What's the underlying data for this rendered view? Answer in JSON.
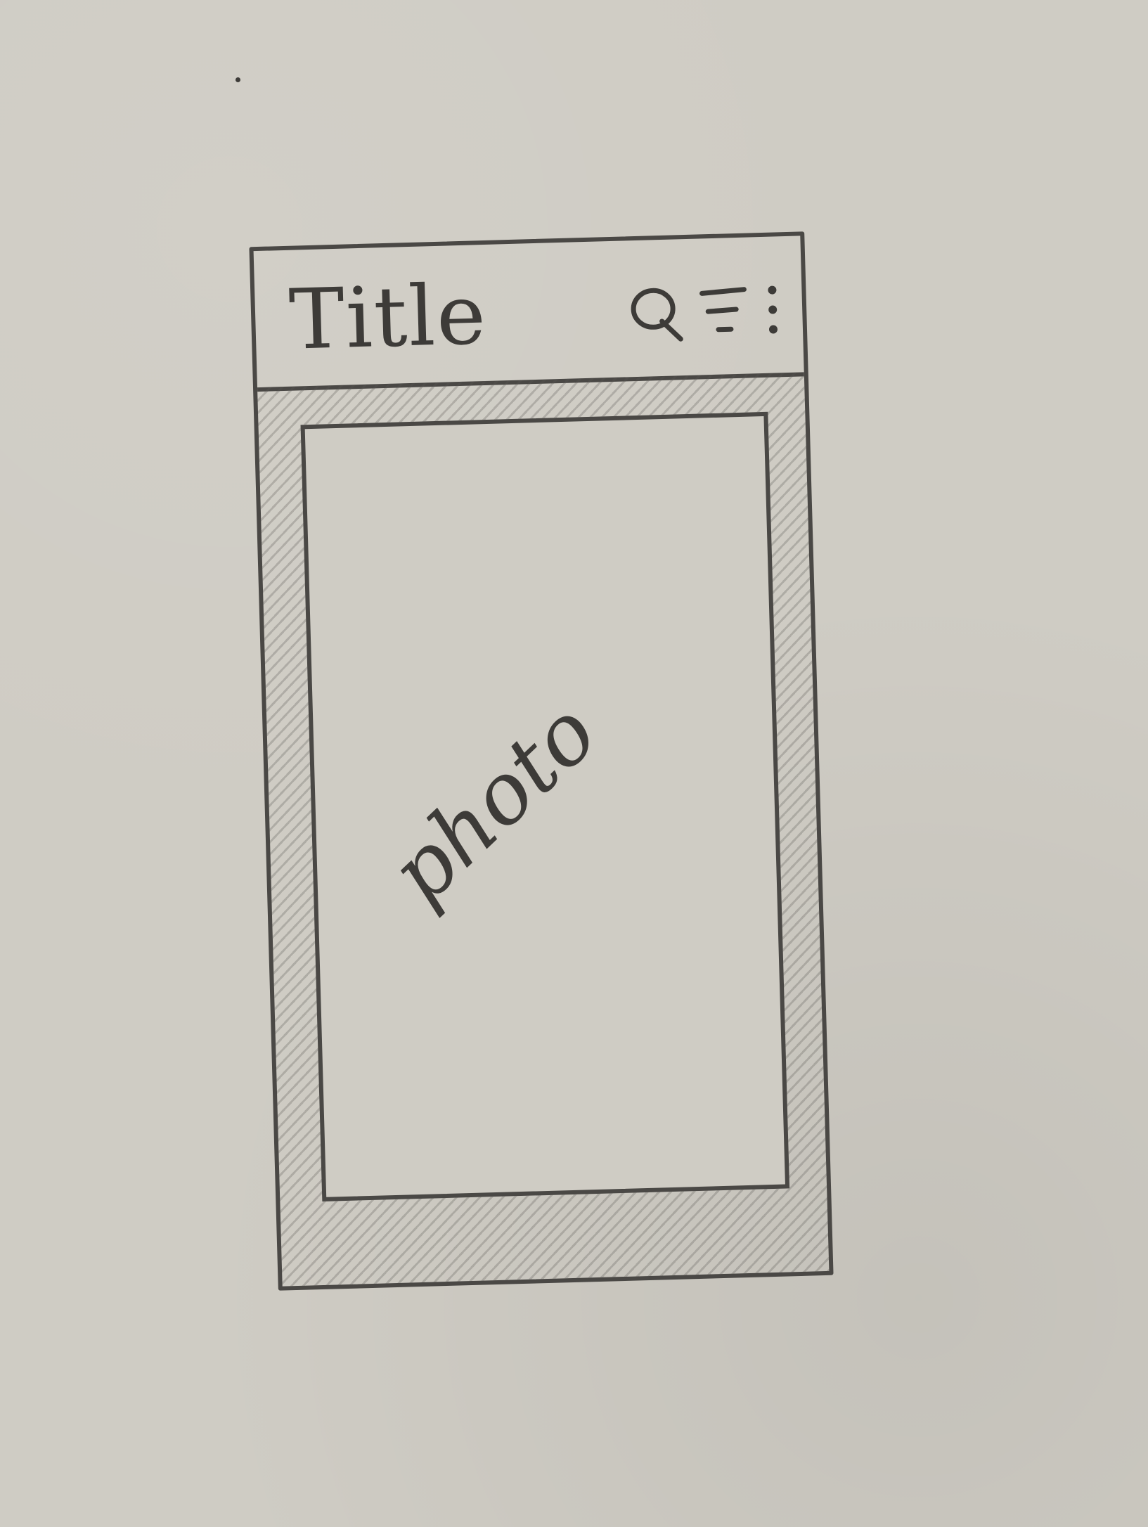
{
  "app_bar": {
    "title": "Title",
    "actions": [
      {
        "icon": "search-icon"
      },
      {
        "icon": "filter-icon"
      },
      {
        "icon": "more-vert-icon"
      }
    ]
  },
  "content": {
    "photo_label": "photo"
  },
  "colors": {
    "paper": "#cfccc4",
    "ink": "#4a4845"
  }
}
